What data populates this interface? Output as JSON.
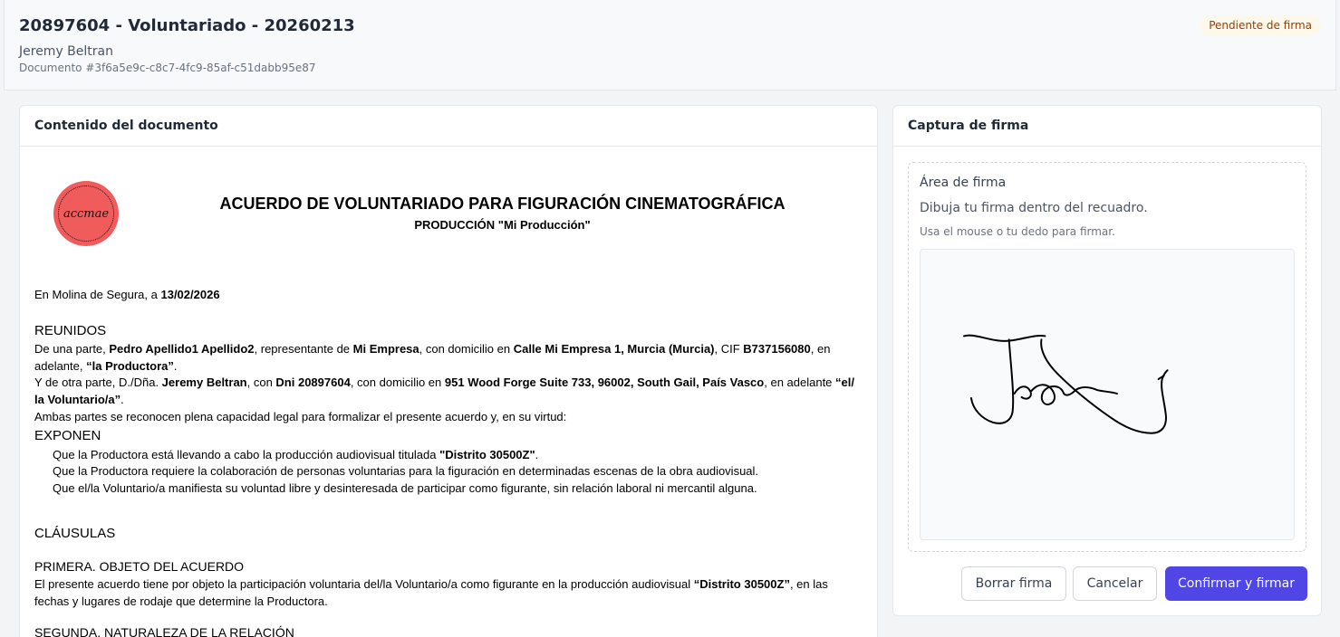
{
  "header": {
    "title": "20897604 - Voluntariado - 20260213",
    "owner": "Jeremy Beltran",
    "document_id": "Documento #3f6a5e9c-c8c7-4fc9-85af-c51dabb95e87",
    "status": "Pendiente de firma",
    "status_color": "#92400e"
  },
  "document_panel": {
    "heading": "Contenido del documento",
    "logo_text": "accmae",
    "title": "ACUERDO DE VOLUNTARIADO PARA FIGURACIÓN CINEMATOGRÁFICA",
    "subtitle": "PRODUCCIÓN \"Mi Producción\"",
    "place_prefix": "En Molina de Segura, a ",
    "date": "13/02/2026",
    "reunidos": "REUNIDOS",
    "p1": {
      "a": "De una parte, ",
      "rep_name": "Pedro Apellido1 Apellido2",
      "b": ", representante de ",
      "company": "Mi Empresa",
      "c": ", con domicilio en ",
      "company_address": "Calle Mi Empresa 1, Murcia (Murcia)",
      "d": ", CIF ",
      "cif": "B737156080",
      "e": ", en",
      "f": "adelante, ",
      "prod_alias": "“la Productora”",
      "g": "."
    },
    "p2": {
      "a": "Y de otra parte, D./Dña. ",
      "vol_name": "Jeremy Beltran",
      "b": ", con ",
      "dni": "Dni 20897604",
      "c": ", con domicilio en ",
      "vol_address": "951 Wood Forge Suite 733, 96002, South Gail, País Vasco",
      "d": ", en adelante ",
      "alias1": "“el/",
      "alias2": "la Voluntario/a”",
      "e": "."
    },
    "p3": "Ambas partes se reconocen plena capacidad legal para formalizar el presente acuerdo y, en su virtud:",
    "exponen": "EXPONEN",
    "e1a": "Que la Productora está llevando a cabo la producción audiovisual titulada ",
    "e1_title": "\"Distrito 30500Z\"",
    "e1b": ".",
    "e2": "Que la Productora requiere la colaboración de personas voluntarias para la figuración en determinadas escenas de la obra audiovisual.",
    "e3": "Que el/la Voluntario/a manifiesta su voluntad libre y desinteresada de participar como figurante, sin relación laboral ni mercantil alguna.",
    "clausulas": "CLÁUSULAS",
    "c1_title": "PRIMERA. OBJETO DEL ACUERDO",
    "c1a": "El presente acuerdo tiene por objeto la participación voluntaria del/la Voluntario/a como figurante en la producción audiovisual ",
    "c1_film": "“Distrito 30500Z”",
    "c1b": ", en las",
    "c1c": "fechas y lugares de rodaje que determine la Productora.",
    "c2_title": "SEGUNDA. NATURALEZA DE LA RELACIÓN"
  },
  "signature_panel": {
    "heading": "Captura de firma",
    "area_label": "Área de firma",
    "help": "Dibuja tu firma dentro del recuadro.",
    "hint": "Usa el mouse o tu dedo para firmar.",
    "buttons": {
      "clear": "Borrar firma",
      "cancel": "Cancelar",
      "confirm": "Confirmar y firmar"
    },
    "accent_color": "#4f46e5"
  }
}
